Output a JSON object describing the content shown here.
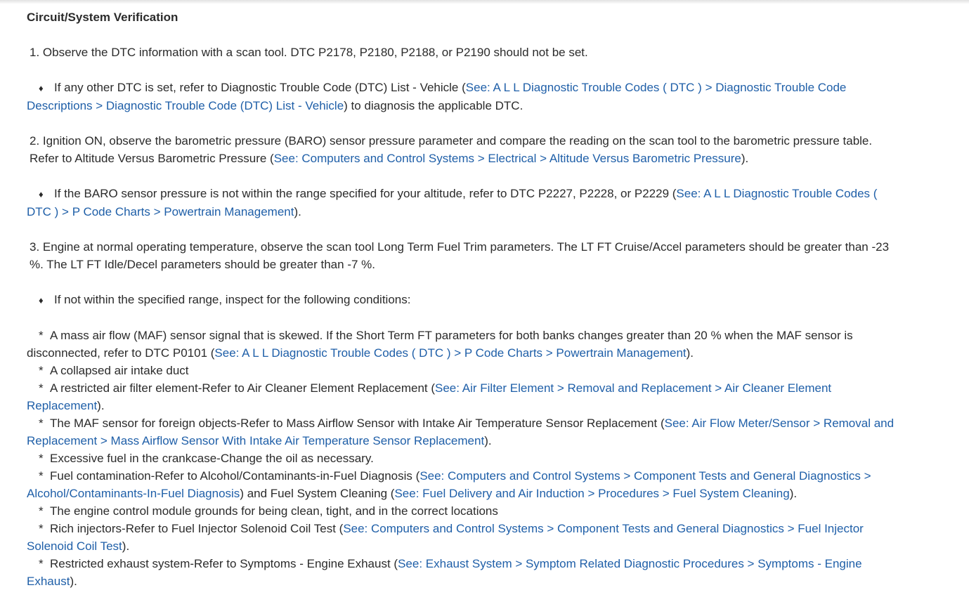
{
  "heading": "Circuit/System Verification",
  "step1": {
    "text": "1. Observe the DTC information with a scan tool. DTC P2178, P2180, P2188, or P2190 should not be set.",
    "sub_text_pre": "If any other DTC is set, refer to Diagnostic Trouble Code (DTC) List - Vehicle (",
    "sub_link": "See: A L L Diagnostic Trouble Codes ( DTC ) > Diagnostic Trouble Code Descriptions > Diagnostic Trouble Code (DTC) List - Vehicle",
    "sub_text_post": ") to diagnosis the applicable DTC."
  },
  "step2": {
    "text_pre": "2. Ignition ON, observe the barometric pressure (BARO) sensor pressure parameter and compare the reading on the scan tool to the barometric pressure table. Refer to Altitude Versus Barometric Pressure (",
    "link": "See: Computers and Control Systems > Electrical > Altitude Versus Barometric Pressure",
    "text_post": ").",
    "sub_text_pre": "If the BARO sensor pressure is not within the range specified for your altitude, refer to DTC P2227, P2228, or P2229 (",
    "sub_link": "See: A L L Diagnostic Trouble Codes ( DTC ) > P Code Charts > Powertrain Management",
    "sub_text_post": ")."
  },
  "step3": {
    "text": "3. Engine at normal operating temperature, observe the scan tool Long Term Fuel Trim parameters. The LT FT Cruise/Accel parameters should be greater than -23 %. The LT FT Idle/Decel parameters should be greater than -7 %.",
    "sub_text": "If not within the specified range, inspect for the following conditions:"
  },
  "bullet_glyph": "♦",
  "star_glyph": "*",
  "conditions": [
    {
      "pre": "A mass air flow (MAF) sensor signal that is skewed. If the Short Term FT parameters for both banks changes greater than 20 % when the MAF sensor is disconnected, refer to DTC P0101 (",
      "link": "See: A L L Diagnostic Trouble Codes ( DTC ) > P Code Charts > Powertrain Management",
      "post": ")."
    },
    {
      "pre": "A collapsed air intake duct"
    },
    {
      "pre": "A restricted air filter element-Refer to Air Cleaner Element Replacement (",
      "link": "See: Air Filter Element > Removal and Replacement > Air Cleaner Element Replacement",
      "post": ")."
    },
    {
      "pre": "The MAF sensor for foreign objects-Refer to Mass Airflow Sensor with Intake Air Temperature Sensor Replacement (",
      "link": "See: Air Flow Meter/Sensor > Removal and Replacement > Mass Airflow Sensor With Intake Air Temperature Sensor Replacement",
      "post": ")."
    },
    {
      "pre": "Excessive fuel in the crankcase-Change the oil as necessary."
    },
    {
      "pre": "Fuel contamination-Refer to Alcohol/Contaminants-in-Fuel Diagnosis (",
      "link": "See: Computers and Control Systems > Component Tests and General Diagnostics > Alcohol/Contaminants-In-Fuel Diagnosis",
      "mid": ") and Fuel System Cleaning (",
      "link2": "See: Fuel Delivery and Air Induction > Procedures > Fuel System Cleaning",
      "post": ")."
    },
    {
      "pre": "The engine control module grounds for being clean, tight, and in the correct locations"
    },
    {
      "pre": "Rich injectors-Refer to Fuel Injector Solenoid Coil Test (",
      "link": "See: Computers and Control Systems > Component Tests and General Diagnostics > Fuel Injector Solenoid Coil Test",
      "post": ")."
    },
    {
      "pre": "Restricted exhaust system-Refer to Symptoms - Engine Exhaust (",
      "link": "See: Exhaust System > Symptom Related Diagnostic Procedures > Symptoms - Engine Exhaust",
      "post": ")."
    }
  ],
  "colors": {
    "text": "#2b2b2b",
    "link": "#1f5fa8"
  }
}
